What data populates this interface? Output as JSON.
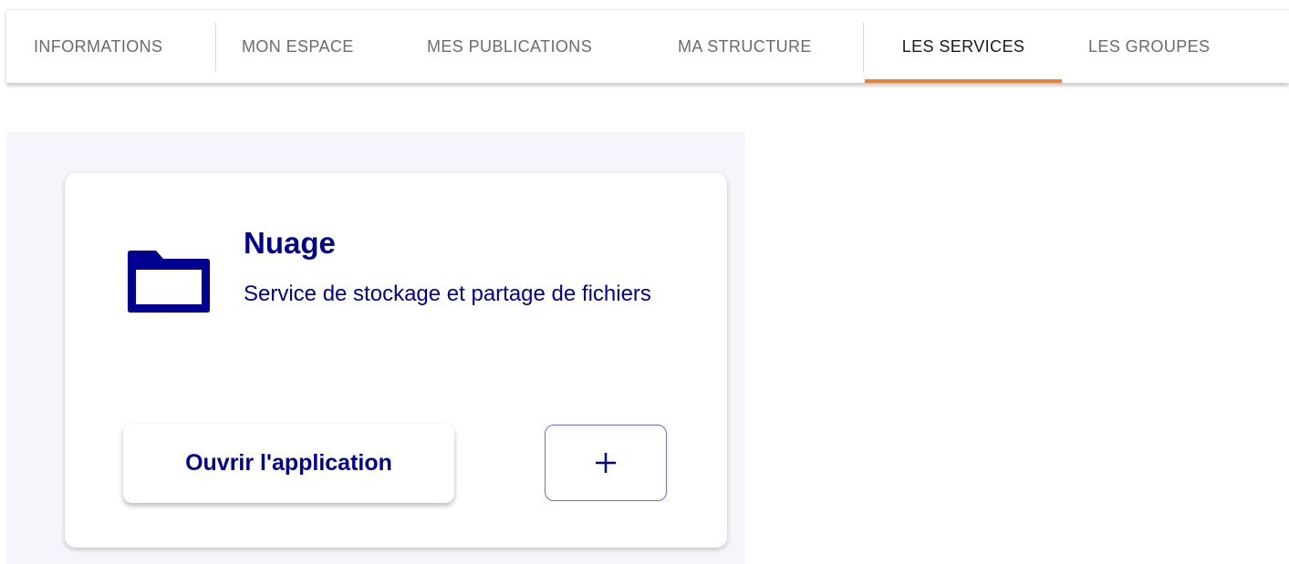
{
  "nav": {
    "tabs": [
      {
        "label": "INFORMATIONS"
      },
      {
        "label": "MON ESPACE"
      },
      {
        "label": "MES PUBLICATIONS"
      },
      {
        "label": "MA STRUCTURE"
      },
      {
        "label": "LES SERVICES",
        "active": true
      },
      {
        "label": "LES GROUPES"
      }
    ]
  },
  "service": {
    "icon": "folder-icon",
    "title": "Nuage",
    "description": "Service de stockage et partage de fichiers",
    "open_label": "Ouvrir l'application",
    "add_icon": "plus-icon"
  },
  "colors": {
    "primary": "#000091",
    "accent": "#e8833a",
    "button_border": "#6a6af4",
    "panel_background": "#f5f6fb",
    "tab_text": "#6b6b6b",
    "tab_text_active": "#1a1a1a"
  }
}
